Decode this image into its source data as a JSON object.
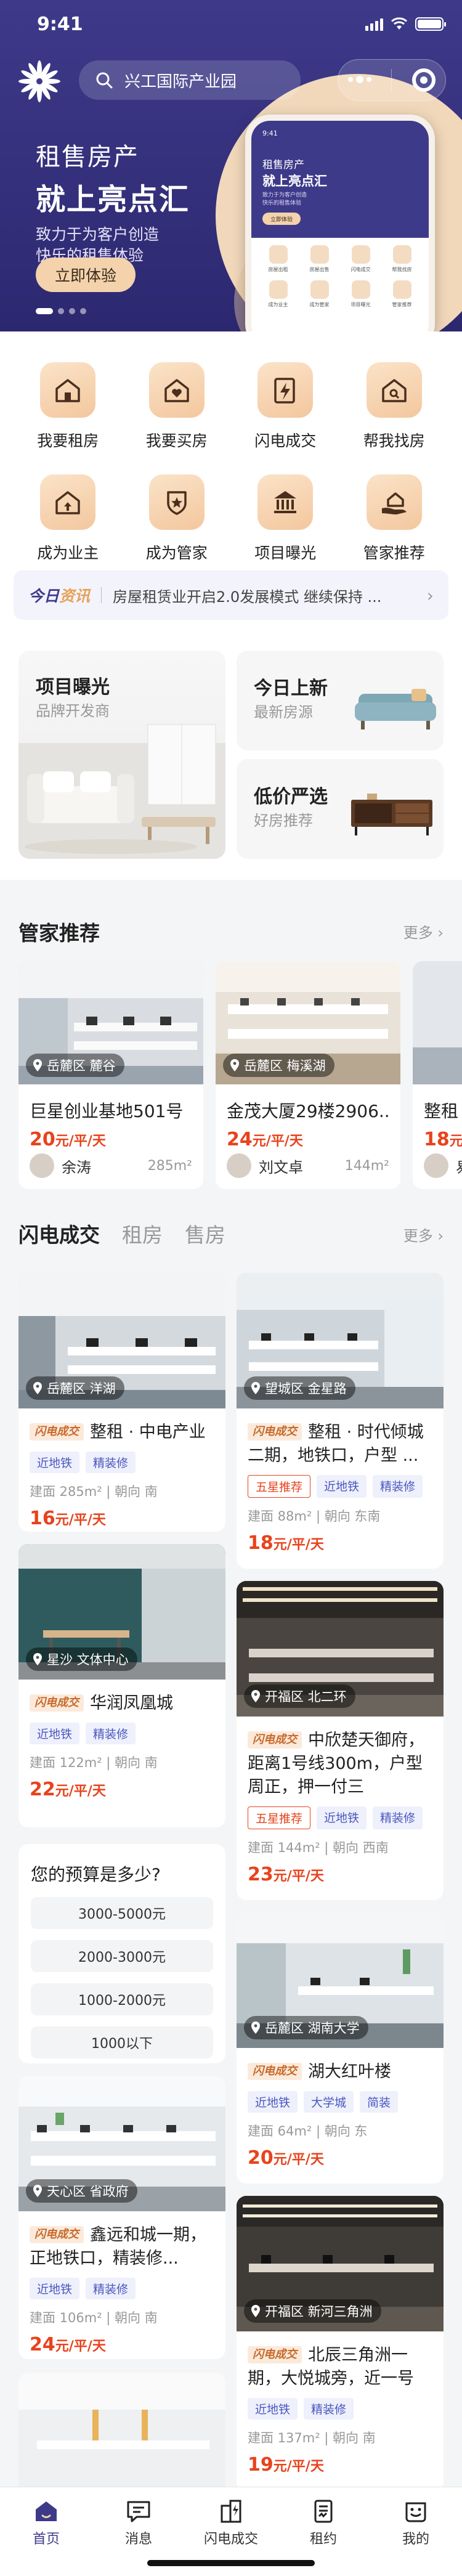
{
  "status_bar": {
    "time": "9:41"
  },
  "search": {
    "placeholder": "兴工国际产业园"
  },
  "hero": {
    "line1": "租售房产",
    "line2": "就上亮点汇",
    "line3": "致力于为客户创造",
    "line4": "快乐的租售体验",
    "button": "立即体验",
    "phone_line1": "租售房产",
    "phone_line2": "就上亮点汇",
    "phone_line3": "致力于为客户创造",
    "phone_line4": "快乐的租售体验",
    "phone_button": "立即体验",
    "phone_time": "9:41",
    "phone_items": [
      "房屋出租",
      "房屋出售",
      "闪电成交",
      "帮我找房",
      "成为业主",
      "成为管家",
      "项目曝光",
      "管家推荐"
    ]
  },
  "quick_menu": [
    {
      "label": "我要租房",
      "icon": "house-icon"
    },
    {
      "label": "我要买房",
      "icon": "house-heart-icon"
    },
    {
      "label": "闪电成交",
      "icon": "lightning-doc-icon"
    },
    {
      "label": "帮我找房",
      "icon": "house-search-icon"
    },
    {
      "label": "成为业主",
      "icon": "house-up-icon"
    },
    {
      "label": "成为管家",
      "icon": "shield-star-icon"
    },
    {
      "label": "项目曝光",
      "icon": "building-icon"
    },
    {
      "label": "管家推荐",
      "icon": "hand-house-icon"
    }
  ],
  "news": {
    "tag_a": "今日",
    "tag_b": "资讯",
    "text": "房屋租赁业开启2.0发展模式 继续保持 ..."
  },
  "promos": {
    "big": {
      "title": "项目曝光",
      "subtitle": "品牌开发商"
    },
    "new": {
      "title": "今日上新",
      "subtitle": "最新房源"
    },
    "cheap": {
      "title": "低价严选",
      "subtitle": "好房推荐"
    }
  },
  "stewards_section": {
    "title": "管家推荐",
    "more": "更多 ›"
  },
  "stewards": [
    {
      "location": "岳麓区 麓谷",
      "title": "巨星创业基地501号",
      "price": "20",
      "unit": "元/平/天",
      "agent": "余涛",
      "area": "285m²"
    },
    {
      "location": "岳麓区 梅溪湖",
      "title": "金茂大厦29楼2906...",
      "price": "24",
      "unit": "元/平/天",
      "agent": "刘文卓",
      "area": "144m²"
    },
    {
      "location": "",
      "title": "整租",
      "price": "18",
      "unit": "元/平/天",
      "agent": "易",
      "area": ""
    }
  ],
  "feed_tabs": {
    "tabs": [
      "闪电成交",
      "租房",
      "售房"
    ],
    "more": "更多 ›"
  },
  "feed": [
    {
      "location": "岳麓区 洋湖",
      "flag": "闪电成交",
      "title": "整租 · 中电产业",
      "tags": [
        "近地铁",
        "精装修"
      ],
      "meta": "建面 285m² | 朝向 南",
      "price": "16",
      "unit": "元/平/天"
    },
    {
      "location": "望城区 金星路",
      "flag": "闪电成交",
      "title": "整租 · 时代倾城二期，地铁口，户型 ...",
      "tags": [
        "五星推荐",
        "近地铁",
        "精装修"
      ],
      "meta": "建面 88m² | 朝向 东南",
      "price": "18",
      "unit": "元/平/天"
    },
    {
      "location": "星沙 文体中心",
      "flag": "闪电成交",
      "title": "华润凤凰城",
      "tags": [
        "近地铁",
        "精装修"
      ],
      "meta": "建面 122m² | 朝向 南",
      "price": "22",
      "unit": "元/平/天"
    },
    {
      "location": "开福区 北二环",
      "flag": "闪电成交",
      "title": "中欣楚天御府，距离1号线300m，户型周正，押一付三",
      "tags": [
        "五星推荐",
        "近地铁",
        "精装修"
      ],
      "meta": "建面 144m² | 朝向 西南",
      "price": "23",
      "unit": "元/平/天"
    },
    {
      "location": "岳麓区 湖南大学",
      "flag": "闪电成交",
      "title": "湖大红叶楼",
      "tags": [
        "近地铁",
        "大学城",
        "简装"
      ],
      "meta": "建面 64m² | 朝向 东",
      "price": "20",
      "unit": "元/平/天"
    },
    {
      "location": "天心区 省政府",
      "flag": "闪电成交",
      "title": "鑫远和城一期，正地铁口，精装修...",
      "tags": [
        "近地铁",
        "精装修"
      ],
      "meta": "建面 106m² | 朝向 南",
      "price": "24",
      "unit": "元/平/天"
    },
    {
      "location": "开福区 新河三角洲",
      "flag": "闪电成交",
      "title": "北辰三角洲一期，大悦城旁，近一号",
      "tags": [
        "近地铁",
        "精装修"
      ],
      "meta": "建面 137m² | 朝向 南",
      "price": "19",
      "unit": "元/平/天"
    }
  ],
  "budget": {
    "title": "您的预算是多少?",
    "options": [
      "3000-5000元",
      "2000-3000元",
      "1000-2000元",
      "1000以下"
    ]
  },
  "tabbar": [
    {
      "label": "首页",
      "icon": "home-icon",
      "active": true
    },
    {
      "label": "消息",
      "icon": "message-icon",
      "active": false
    },
    {
      "label": "闪电成交",
      "icon": "lightning-building-icon",
      "active": false
    },
    {
      "label": "租约",
      "icon": "contract-icon",
      "active": false
    },
    {
      "label": "我的",
      "icon": "smile-icon",
      "active": false
    }
  ],
  "colors": {
    "brand": "#3e3a8a",
    "accent": "#f3d2ac",
    "price": "#e8431c"
  }
}
